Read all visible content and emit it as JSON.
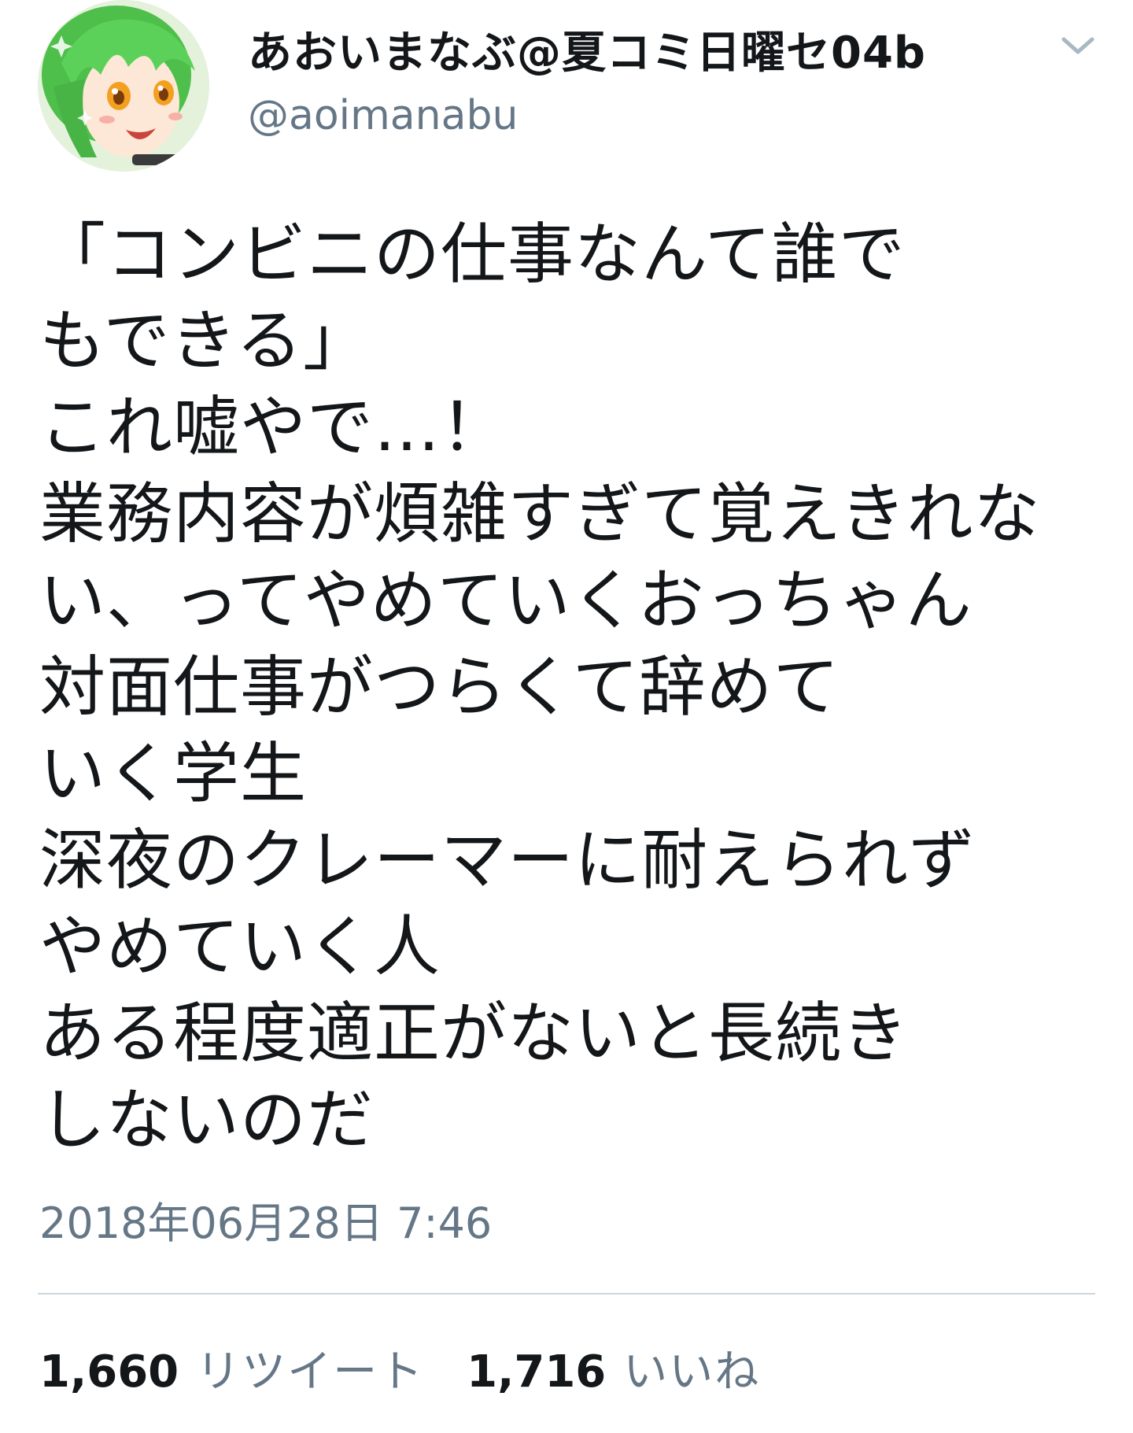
{
  "user": {
    "display_name": "あおいまなぶ@夏コミ日曜セ04b",
    "handle": "@aoimanabu",
    "avatar_icon": "anime-avatar-icon"
  },
  "menu": {
    "icon": "chevron-down-icon"
  },
  "tweet": {
    "lines": [
      "「コンビニの仕事なんて誰で",
      "もできる」",
      "これ嘘やで…！",
      "業務内容が煩雑すぎて覚えきれな",
      "い、ってやめていくおっちゃん",
      "対面仕事がつらくて辞めて",
      "いく学生",
      "深夜のクレーマーに耐えられず",
      "やめていく人",
      "ある程度適正がないと長続き",
      "しないのだ"
    ],
    "timestamp": "2018年06月28日 7:46"
  },
  "stats": {
    "retweets": {
      "count": "1,660",
      "label": "リツイート"
    },
    "likes": {
      "count": "1,716",
      "label": "いいね"
    }
  },
  "colors": {
    "text": "#14171a",
    "secondary": "#657786",
    "divider": "#ccd6dd",
    "avatar_hair": "#5cc85a"
  }
}
